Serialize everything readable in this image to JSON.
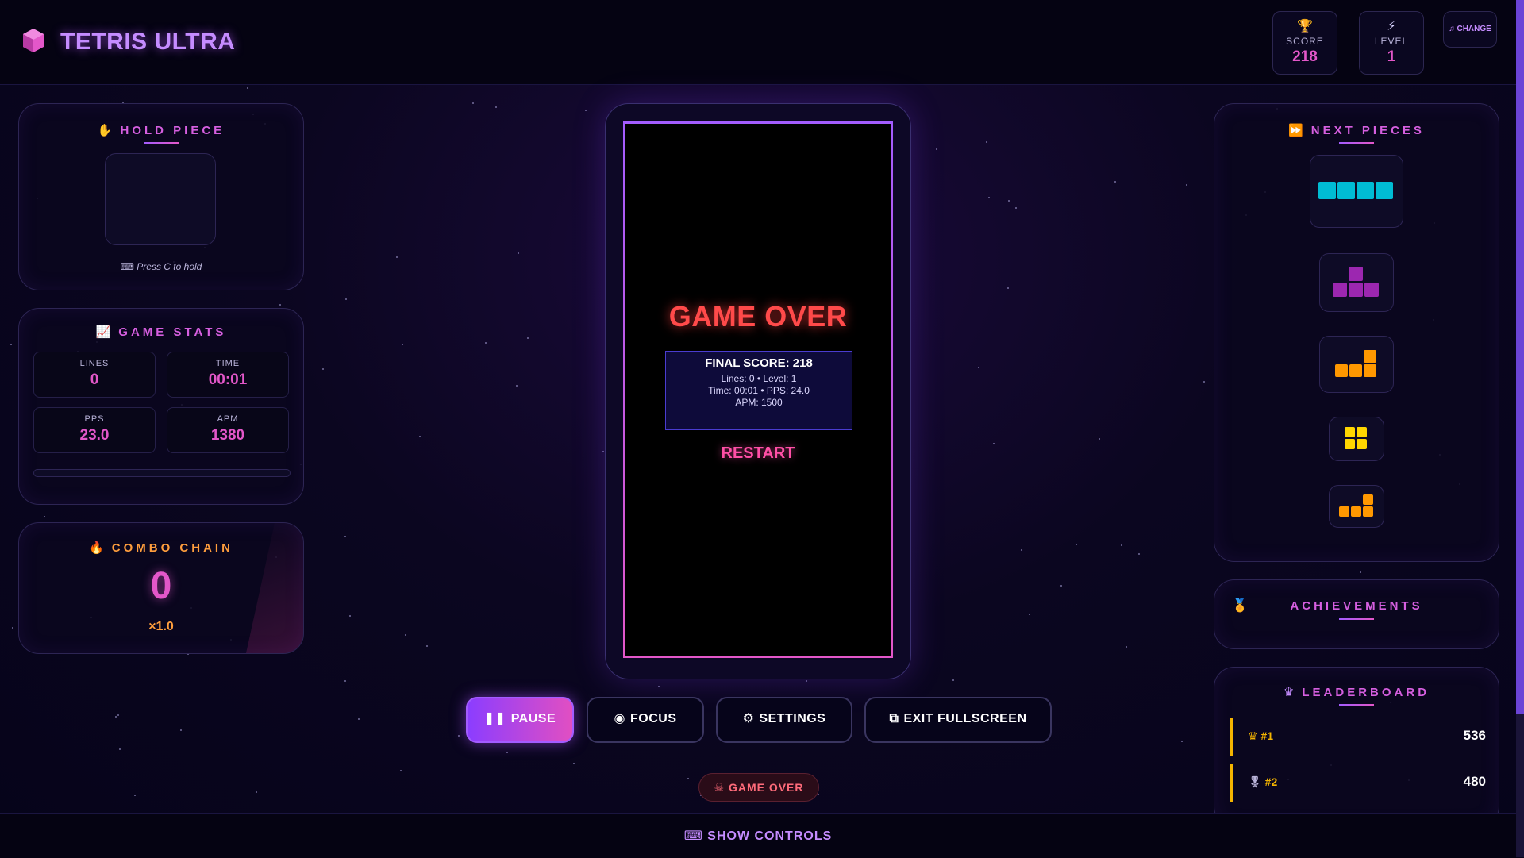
{
  "app": {
    "title": "TETRIS ULTRA"
  },
  "hud": {
    "score_label": "SCORE",
    "score_value": "218",
    "level_label": "LEVEL",
    "level_value": "1",
    "change_label": "CHANGE"
  },
  "hold": {
    "title": "HOLD PIECE",
    "hint": "Press C to hold"
  },
  "stats": {
    "title": "GAME STATS",
    "lines_label": "LINES",
    "lines_value": "0",
    "time_label": "TIME",
    "time_value": "00:01",
    "pps_label": "PPS",
    "pps_value": "23.0",
    "apm_label": "APM",
    "apm_value": "1380"
  },
  "combo": {
    "title": "COMBO CHAIN",
    "value": "0",
    "multiplier": "×1.0"
  },
  "game_over": {
    "title": "GAME OVER",
    "final_score": "FINAL SCORE: 218",
    "line1": "Lines: 0  •  Level: 1",
    "line2": "Time: 00:01  •  PPS: 24.0",
    "line3": "APM: 1500",
    "restart_label": "RESTART"
  },
  "controls": {
    "pause_label": "PAUSE",
    "focus_label": "FOCUS",
    "settings_label": "SETTINGS",
    "fullscreen_label": "EXIT FULLSCREEN"
  },
  "status": {
    "label": "GAME OVER"
  },
  "bottom": {
    "show_controls_label": "SHOW CONTROLS"
  },
  "next": {
    "title": "NEXT PIECES",
    "pieces": [
      "I",
      "T",
      "L",
      "O",
      "L"
    ]
  },
  "achievements": {
    "title": "ACHIEVEMENTS"
  },
  "leaderboard": {
    "title": "LEADERBOARD",
    "entries": [
      {
        "rank": "#1",
        "score": "536"
      },
      {
        "rank": "#2",
        "score": "480"
      }
    ]
  },
  "colors": {
    "accent": "#e357c9",
    "purple": "#a35cff",
    "I": "#00bcd4",
    "T": "#9c27b0",
    "L": "#ff9800",
    "O": "#ffd600",
    "danger": "#ff4a4a"
  }
}
